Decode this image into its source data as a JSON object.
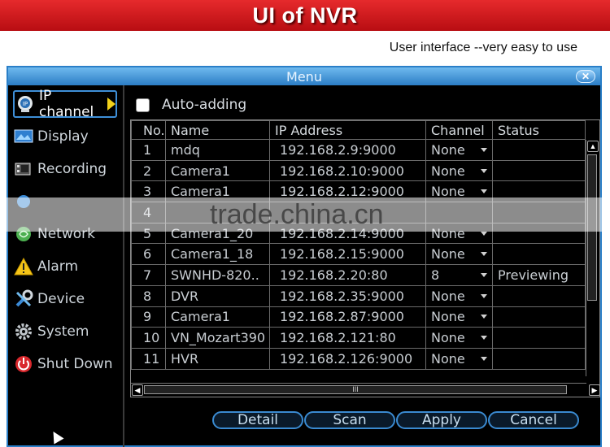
{
  "banner": {
    "title": "UI of NVR",
    "subtitle": "User interface --very easy to use"
  },
  "window": {
    "title": "Menu"
  },
  "sidebar": {
    "items": [
      {
        "label": "IP channel",
        "icon": "ip-camera-icon",
        "active": true
      },
      {
        "label": "Display",
        "icon": "display-icon"
      },
      {
        "label": "Recording",
        "icon": "recording-icon"
      },
      {
        "label": "",
        "icon": "record-dot-icon"
      },
      {
        "label": "Network",
        "icon": "network-icon"
      },
      {
        "label": "Alarm",
        "icon": "alarm-icon"
      },
      {
        "label": "Device",
        "icon": "device-icon"
      },
      {
        "label": "System",
        "icon": "system-gear-icon"
      },
      {
        "label": "Shut Down",
        "icon": "power-icon"
      }
    ]
  },
  "auto_adding": {
    "label": "Auto-adding",
    "checked": false
  },
  "table": {
    "headers": [
      "No.",
      "Name",
      "IP Address",
      "Channel",
      "Status"
    ],
    "rows": [
      {
        "no": "1",
        "name": "mdq",
        "ip": "192.168.2.9:9000",
        "channel": "None",
        "status": ""
      },
      {
        "no": "2",
        "name": "Camera1",
        "ip": "192.168.2.10:9000",
        "channel": "None",
        "status": ""
      },
      {
        "no": "3",
        "name": "Camera1",
        "ip": "192.168.2.12:9000",
        "channel": "None",
        "status": ""
      },
      {
        "no": "4",
        "name": "",
        "ip": "",
        "channel": "",
        "status": ""
      },
      {
        "no": "5",
        "name": "Camera1_20",
        "ip": "192.168.2.14:9000",
        "channel": "None",
        "status": ""
      },
      {
        "no": "6",
        "name": "Camera1_18",
        "ip": "192.168.2.15:9000",
        "channel": "None",
        "status": ""
      },
      {
        "no": "7",
        "name": "SWNHD-820..",
        "ip": "192.168.2.20:80",
        "channel": "8",
        "status": "Previewing"
      },
      {
        "no": "8",
        "name": "DVR",
        "ip": "192.168.2.35:9000",
        "channel": "None",
        "status": ""
      },
      {
        "no": "9",
        "name": "Camera1",
        "ip": "192.168.2.87:9000",
        "channel": "None",
        "status": ""
      },
      {
        "no": "10",
        "name": "VN_Mozart390",
        "ip": "192.168.2.121:80",
        "channel": "None",
        "status": ""
      },
      {
        "no": "11",
        "name": "HVR",
        "ip": "192.168.2.126:9000",
        "channel": "None",
        "status": ""
      }
    ]
  },
  "buttons": {
    "detail": "Detail",
    "scan": "Scan",
    "apply": "Apply",
    "cancel": "Cancel"
  },
  "watermark": "trade.china.cn",
  "colors": {
    "banner_red": "#d61f24",
    "accent_blue": "#2b7dc5",
    "active_arrow": "#f2d21a"
  }
}
